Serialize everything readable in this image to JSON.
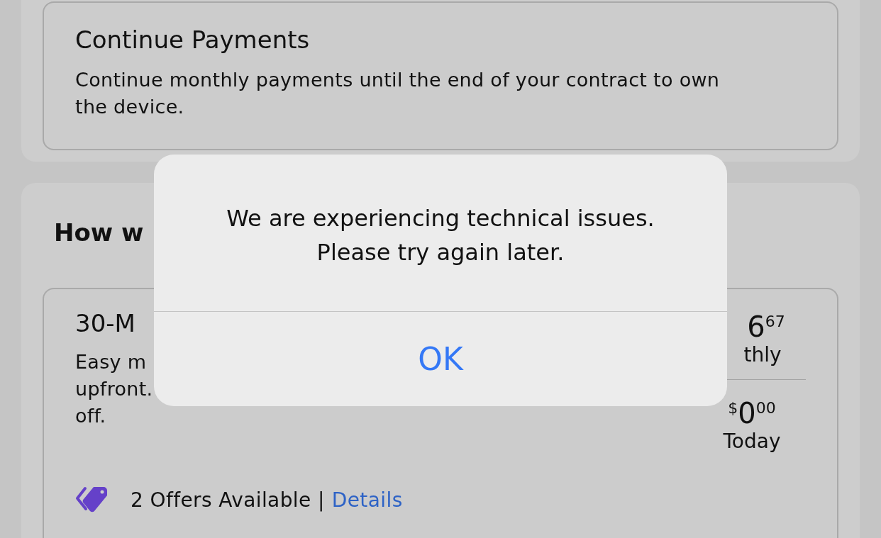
{
  "options": [
    {
      "title": "Continue Payments",
      "description": "Continue monthly payments until the end of your contract to own the device."
    }
  ],
  "section": {
    "heading": "How w",
    "plan": {
      "title": "30-M",
      "description_lines": [
        "Easy m",
        "upfront.",
        "off."
      ],
      "monthly_price": {
        "main": "6",
        "cents": "67",
        "label": "thly"
      },
      "today_price": {
        "currency": "$",
        "main": "0",
        "cents": "00",
        "label": "Today"
      },
      "offers": {
        "text": "2 Offers Available |",
        "link": "Details"
      }
    }
  },
  "alert": {
    "message_lines": [
      "We are experiencing technical issues.",
      "Please try again later."
    ],
    "button": "OK"
  }
}
